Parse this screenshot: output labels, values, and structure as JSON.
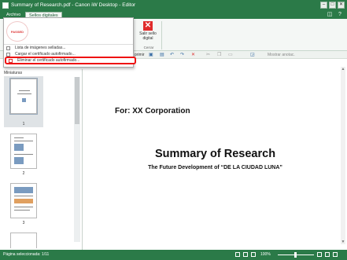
{
  "window": {
    "title": "Summary of Research.pdf - Canon iW Desktop - Editor",
    "buttons": [
      "–",
      "□",
      "✕"
    ]
  },
  "ribbon": {
    "tabs": [
      {
        "label": "Archivo",
        "active": false
      },
      {
        "label": "Sellos digitales",
        "active": true
      }
    ],
    "exit_button": "Salir sello digital",
    "group_label": "Cerrar"
  },
  "menu": {
    "stamp_text": "PASSED",
    "items": [
      {
        "label": "Lista de imágenes selladas..."
      },
      {
        "label": "Cargar el certificado autofirmado..."
      },
      {
        "label": "Eliminar el certificado autofirmado..."
      }
    ]
  },
  "toolbar": {
    "print_label": "primir",
    "show_annotations": "Mostrar anotac."
  },
  "thumbnails": {
    "header": "Miniaturas",
    "pages": [
      "1",
      "2",
      "3"
    ]
  },
  "document": {
    "for_line": "For: XX Corporation",
    "title": "Summary of Research",
    "subtitle": "The Future Development of “DE LA CIUDAD LUNA”"
  },
  "status": {
    "page_info": "Página seleccionada: 1/11",
    "zoom": "100%"
  },
  "colors": {
    "accent": "#2b7a48",
    "highlight": "#e11111",
    "exit": "#e02b2b"
  }
}
